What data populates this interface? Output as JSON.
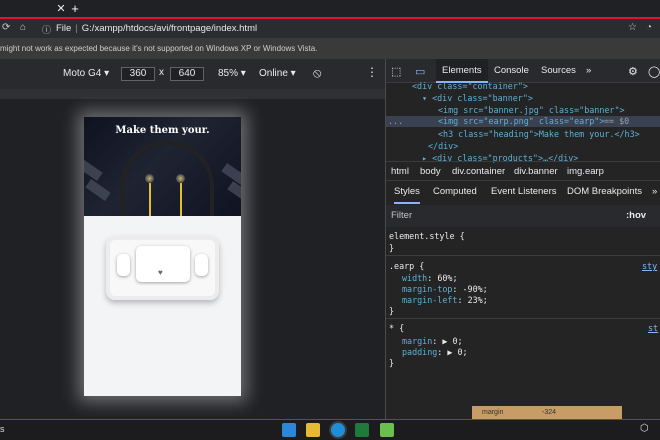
{
  "browser": {
    "url_scheme": "File",
    "url_path": "G:/xampp/htdocs/avi/frontpage/index.html",
    "infobar_text": "might not work as expected because it's not supported on Windows XP or Windows Vista."
  },
  "device_toolbar": {
    "device": "Moto G4",
    "width": "360",
    "height": "640",
    "times": "x",
    "zoom": "85%",
    "network": "Online"
  },
  "page": {
    "heading": "Make them your."
  },
  "devtools": {
    "tabs": [
      "Elements",
      "Console",
      "Sources"
    ],
    "more_tabs": "»",
    "dom": {
      "l0": "<div class=\"container\">",
      "l1": "<div class=\"banner\">",
      "l2_tag": "<img src=\"banner.jpg\" class=\"banner\">",
      "l3_tag": "<img src=\"earp.png\" class=\"earp\">",
      "l3_eq": "== $0",
      "l4_tag": "<h3 class=\"heading\">Make them your.</h3>",
      "l5": "</div>",
      "l6": "<div class=\"products\">…</div>",
      "dots": "..."
    },
    "breadcrumbs": [
      "html",
      "body",
      "div.container",
      "div.banner",
      "img.earp"
    ],
    "styles_tabs": [
      "Styles",
      "Computed",
      "Event Listeners",
      "DOM Breakpoints"
    ],
    "styles_more": "»",
    "filter_placeholder": "Filter",
    "hov": ":hov",
    "rules": {
      "element_style": "element.style {",
      "close": "}",
      "earp_selector": ".earp {",
      "earp_source": "sty",
      "earp_props": [
        {
          "name": "width",
          "value": "60%;"
        },
        {
          "name": "margin-top",
          "value": "-90%;"
        },
        {
          "name": "margin-left",
          "value": "23%;"
        }
      ],
      "star_selector": "* {",
      "star_source": "st",
      "star_props": [
        {
          "name": "margin",
          "value": "▶ 0;"
        },
        {
          "name": "padding",
          "value": "▶ 0;"
        }
      ]
    },
    "boxmodel": {
      "label": "margin",
      "value": "-324"
    }
  },
  "colors": {
    "accent_red": "#e0142e",
    "devtools_blue": "#8ab4f8"
  }
}
